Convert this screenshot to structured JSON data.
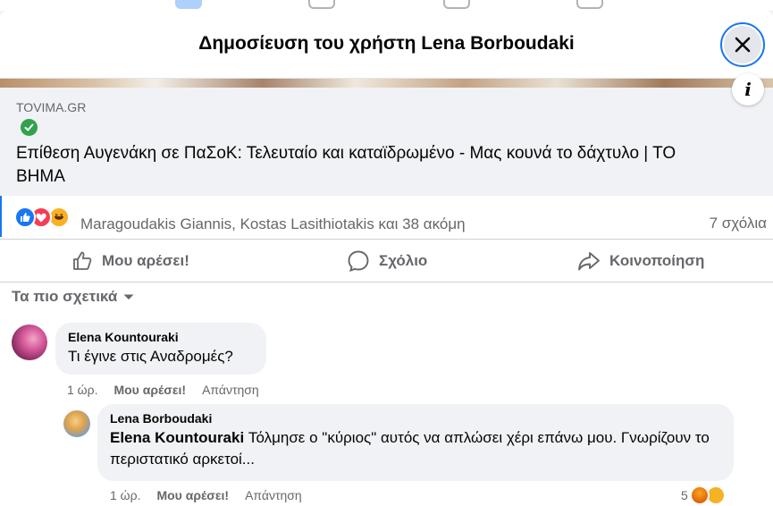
{
  "modal": {
    "title": "Δημοσίευση του χρήστη Lena Borboudaki",
    "close_icon": "close-icon"
  },
  "link_preview": {
    "domain": "TOVIMA.GR",
    "title": "Επίθεση Αυγενάκη σε ΠαΣοΚ: Τελευταίο και καταϊδρωμένο - Μας κουνά το δάχτυλο | ΤΟ ΒΗΜΑ",
    "info_label": "i"
  },
  "reactions": {
    "icons": [
      "like-icon",
      "love-icon",
      "haha-icon"
    ],
    "summary": "Maragoudakis Giannis, Kostas Lasithiotakis και 38 ακόμη",
    "comment_count": "7 σχόλια"
  },
  "actions": {
    "like": "Μου αρέσει!",
    "comment": "Σχόλιο",
    "share": "Κοινοποίηση"
  },
  "sort": {
    "label": "Τα πιο σχετικά"
  },
  "comments": [
    {
      "author": "Elena Kountouraki",
      "text": "Τι έγινε στις Αναδρομές?",
      "time": "1 ώρ.",
      "like": "Μου αρέσει!",
      "reply": "Απάντηση"
    },
    {
      "author": "Lena Borboudaki",
      "mention": "Elena Kountouraki",
      "text": "Τόλμησε ο \"κύριος\" αυτός να απλώσει χέρι επάνω μου. Γνωρίζουν το περιστατικό αρκετοί...",
      "time": "1 ώρ.",
      "like": "Μου αρέσει!",
      "reply": "Απάντηση",
      "reaction_count": "5",
      "reaction_icons": [
        "angry-icon",
        "wow-icon"
      ]
    }
  ],
  "colors": {
    "accent": "#1877f2",
    "secondary_text": "#65676b",
    "bubble": "#f0f2f5"
  }
}
